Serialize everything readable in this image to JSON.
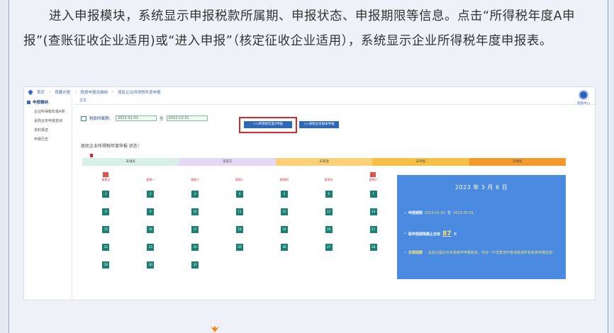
{
  "intro": {
    "text": "进入申报模块，系统显示申报税款所属期、申报状态、申报期限等信息。点击“所得税年度A申报”(查账征收企业适用)或“进入申报”（核定征收企业适用），系统显示企业所得税年度申报表。"
  },
  "topbar": {
    "crumbs": [
      "首页",
      "我要办税",
      "税费申报及缴纳",
      "居民企业所得税年度申报"
    ]
  },
  "sidebar": {
    "title": "申报缴纳",
    "items": [
      "企业所得税年报A类",
      "采购业务申报查询",
      "资料报送",
      "申报历史"
    ]
  },
  "tab": "主页",
  "helper": "帮助中心",
  "period": {
    "label": "税款所属期：",
    "start": "2022-01-01",
    "sep": "至",
    "end": "2022-12-31"
  },
  "buttons": {
    "annual_a": ">>所得税年度A申报",
    "enter": ">>采购业务报表申报"
  },
  "status_label": "居民企业所得税年度申报 状态：",
  "status_bars": [
    {
      "label": "未填表",
      "color": "#d9f0e8"
    },
    {
      "label": "未提交",
      "color": "#e5d8f7"
    },
    {
      "label": "未受理",
      "color": "#fbd077"
    },
    {
      "label": "未申报",
      "color": "#f7c044"
    },
    {
      "label": "未缴税",
      "color": "#f59a2a"
    }
  ],
  "calendar": {
    "weekdays": [
      "星期日",
      "星期一",
      "星期二",
      "星期三",
      "星期四",
      "星期五",
      "星期六"
    ],
    "rows": [
      [
        "1",
        "2",
        "3",
        "4",
        "5",
        "6",
        "7"
      ],
      [
        "8",
        "9",
        "10",
        "11",
        "12",
        "13",
        "14"
      ],
      [
        "15",
        "16",
        "17",
        "18",
        "19",
        "20",
        "21"
      ],
      [
        "22",
        "23",
        "24",
        "25",
        "26",
        "27",
        "28"
      ],
      [
        "29",
        "30",
        "31",
        "",
        "",
        "",
        ""
      ]
    ]
  },
  "info": {
    "date": "2023 年 3 月 6 日",
    "deadline_label": "申报期限",
    "deadline_start": "2023-01-01",
    "deadline_sep": "至",
    "deadline_end": "2023-05-31",
    "remaining_label": "距申报期限截止还有",
    "remaining_days": "87",
    "remaining_unit": "天",
    "tip_label": "友情提醒",
    "tip_text": "：此处只提示在本系统中申报状态，可在一户式查询中查询其他所有系统申报信息！"
  }
}
